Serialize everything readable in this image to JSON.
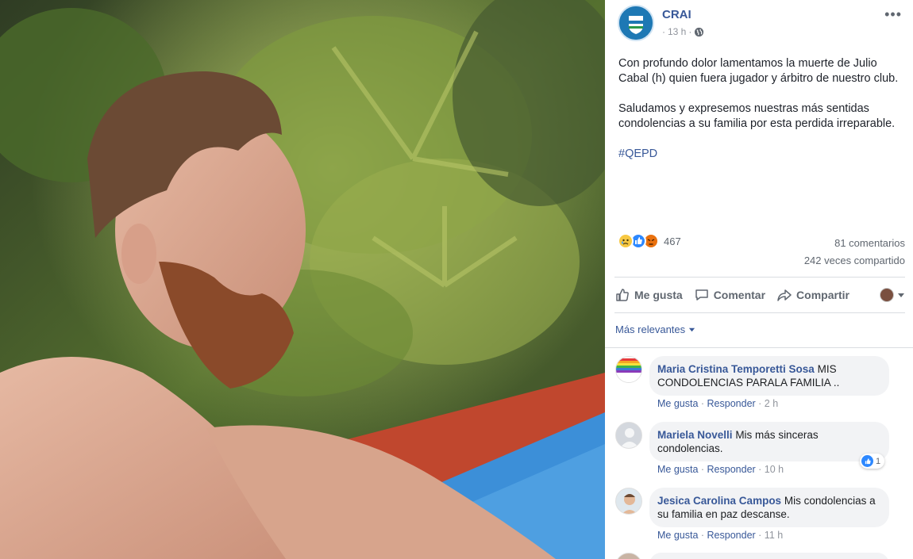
{
  "post": {
    "page_name": "CRAI",
    "time": "13 h",
    "privacy_icon": "globe-icon",
    "text_p1": "Con profundo dolor lamentamos la muerte de Julio Cabal (h) quien fuera jugador y árbitro de nuestro club.",
    "text_p2": "Saludamos y expresemos nuestras más sentidas condolencias a su familia por esta perdida irreparable.",
    "hashtag": "#QEPD"
  },
  "stats": {
    "reaction_icons": [
      "sad-reaction-icon",
      "like-reaction-icon",
      "angry-reaction-icon"
    ],
    "reactions": "467",
    "comments": "81 comentarios",
    "shares": "242 veces compartido"
  },
  "actions": {
    "like": "Me gusta",
    "comment": "Comentar",
    "share": "Compartir"
  },
  "sort_label": "Más relevantes",
  "comments": [
    {
      "name": "Maria Cristina Temporetti Sosa",
      "text": "MIS CONDOLENCIAS PARALA FAMILIA ..",
      "like": "Me gusta",
      "reply": "Responder",
      "time": "2 h",
      "avatar_text": "Orgullosa Diferen"
    },
    {
      "name": "Mariela Novelli",
      "text": "Mis más sinceras condolencias.",
      "like": "Me gusta",
      "reply": "Responder",
      "time": "10 h",
      "like_count": "1"
    },
    {
      "name": "Jesica Carolina Campos",
      "text": "Mis condolencias a su familia en paz descanse.",
      "like": "Me gusta",
      "reply": "Responder",
      "time": "11 h"
    }
  ],
  "colors": {
    "link_blue": "#385898",
    "like_blue": "#2d88ff",
    "muted_gray": "#90949c"
  }
}
